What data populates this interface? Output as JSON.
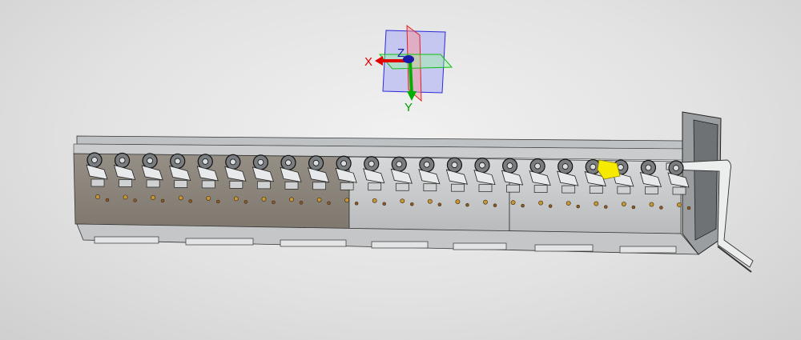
{
  "viewport": {
    "background": "#e4e4e4"
  },
  "triad": {
    "x_label": "X",
    "y_label": "Y",
    "z_label": "Z",
    "x_color": "#e00000",
    "y_color": "#00b000",
    "z_color": "#1a1aa8",
    "plane_front_color": "#9aa0ff",
    "plane_side_color": "#ff6b6b",
    "plane_top_color": "#7cff7c"
  },
  "model": {
    "description_icon": "machine-assembly-icon",
    "left_panel_color": "#8a847c",
    "mid_panel_color": "#c9cbcc",
    "right_panel_color": "#bfc1c3",
    "highlight_color": "#f5ea00",
    "station_count": 22
  }
}
